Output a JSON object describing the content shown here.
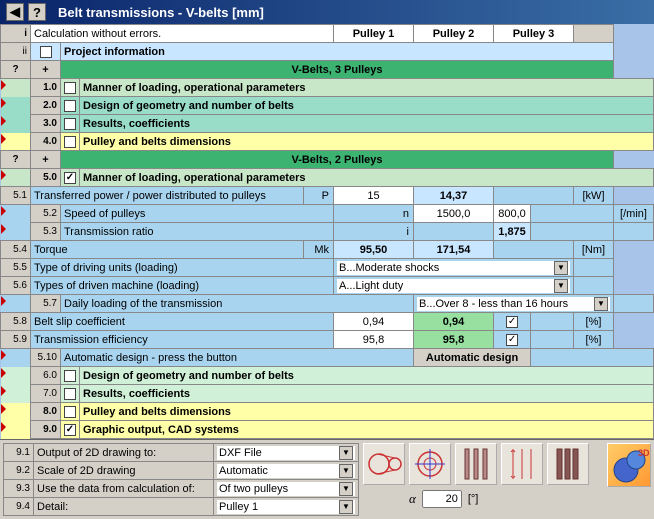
{
  "title": "Belt transmissions - V-belts [mm]",
  "header": {
    "i": "i",
    "ii": "ii",
    "calc": "Calculation without errors.",
    "p1": "Pulley 1",
    "p2": "Pulley 2",
    "p3": "Pulley 3",
    "proj": "Project information"
  },
  "qmark": "?",
  "plus": "+",
  "sec3": "V-Belts, 3 Pulleys",
  "sec2": "V-Belts, 2 Pulleys",
  "r10": {
    "n": "1.0",
    "t": "Manner of loading, operational parameters"
  },
  "r20": {
    "n": "2.0",
    "t": "Design of geometry and number of belts"
  },
  "r30": {
    "n": "3.0",
    "t": "Results, coefficients"
  },
  "r40": {
    "n": "4.0",
    "t": "Pulley and belts dimensions"
  },
  "r50": {
    "n": "5.0",
    "t": "Manner of loading, operational parameters"
  },
  "r51": {
    "n": "5.1",
    "t": "Transferred power / power distributed to pulleys",
    "s": "P",
    "v1": "15",
    "v2": "14,37",
    "u": "[kW]"
  },
  "r52": {
    "n": "5.2",
    "t": "Speed of pulleys",
    "s": "n",
    "v1": "1500,0",
    "v2": "800,0",
    "u": "[/min]"
  },
  "r53": {
    "n": "5.3",
    "t": "Transmission ratio",
    "s": "i",
    "v2": "1,875"
  },
  "r54": {
    "n": "5.4",
    "t": "Torque",
    "s": "Mk",
    "v1": "95,50",
    "v2": "171,54",
    "u": "[Nm]"
  },
  "r55": {
    "n": "5.5",
    "t": "Type of driving units (loading)",
    "d": "B...Moderate shocks"
  },
  "r56": {
    "n": "5.6",
    "t": "Types of driven machine (loading)",
    "d": "A...Light duty"
  },
  "r57": {
    "n": "5.7",
    "t": "Daily loading of the transmission",
    "d": "B...Over 8 - less than 16 hours"
  },
  "r58": {
    "n": "5.8",
    "t": "Belt slip coefficient",
    "v1": "0,94",
    "v2": "0,94",
    "u": "[%]"
  },
  "r59": {
    "n": "5.9",
    "t": "Transmission efficiency",
    "v1": "95,8",
    "v2": "95,8",
    "u": "[%]"
  },
  "r510": {
    "n": "5.10",
    "t": "Automatic design - press the button",
    "b": "Automatic design"
  },
  "r60": {
    "n": "6.0",
    "t": "Design of geometry and number of belts"
  },
  "r70": {
    "n": "7.0",
    "t": "Results, coefficients"
  },
  "r80": {
    "n": "8.0",
    "t": "Pulley and belts dimensions"
  },
  "r90": {
    "n": "9.0",
    "t": "Graphic output, CAD systems"
  },
  "r91": {
    "n": "9.1",
    "t": "Output of 2D drawing to:",
    "d": "DXF File"
  },
  "r92": {
    "n": "9.2",
    "t": "Scale of 2D drawing",
    "d": "Automatic"
  },
  "r93": {
    "n": "9.3",
    "t": "Use the data from calculation of:",
    "d": "Of two pulleys"
  },
  "r94": {
    "n": "9.4",
    "t": "Detail:",
    "d": "Pulley 1"
  },
  "alpha": {
    "s": "α",
    "v": "20",
    "u": "[°]"
  }
}
